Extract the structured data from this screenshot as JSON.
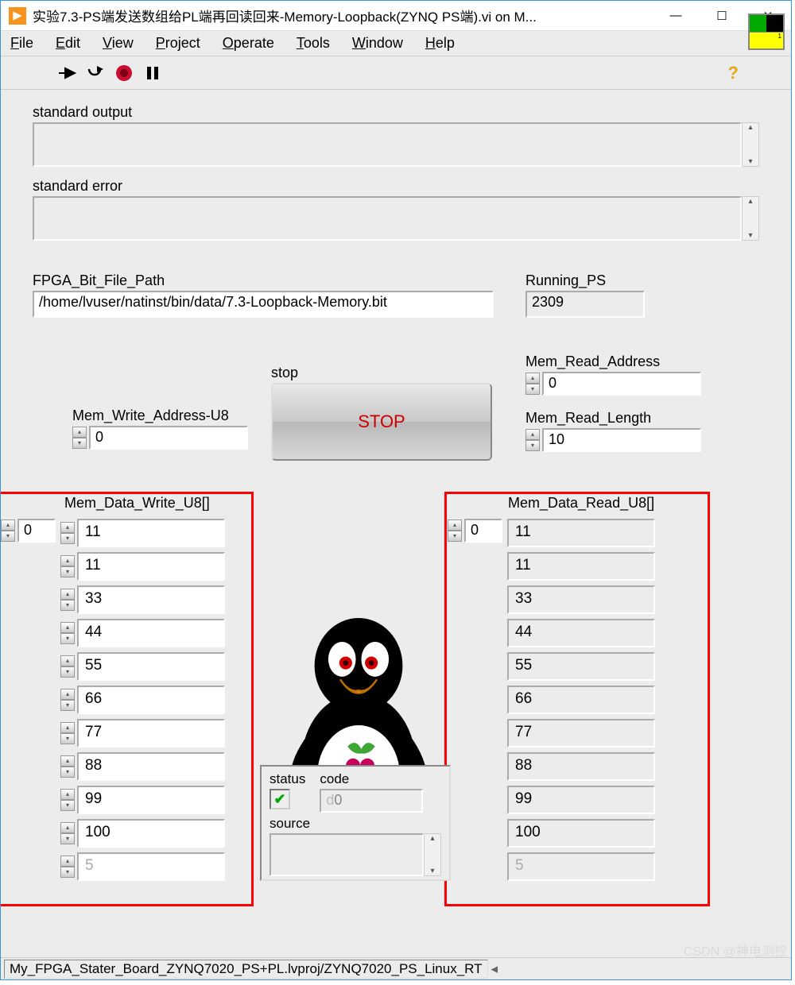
{
  "window": {
    "title": "实验7.3-PS端发送数组给PL端再回读回来-Memory-Loopback(ZYNQ PS端).vi on M..."
  },
  "menu": {
    "file": "File",
    "edit": "Edit",
    "view": "View",
    "project": "Project",
    "operate": "Operate",
    "tools": "Tools",
    "window": "Window",
    "help": "Help"
  },
  "labels": {
    "standard_output": "standard output",
    "standard_error": "standard error",
    "fpga_path": "FPGA_Bit_File_Path",
    "running_ps": "Running_PS",
    "stop_caption": "stop",
    "stop_button": "STOP",
    "mem_write_addr": "Mem_Write_Address-U8",
    "mem_read_addr": "Mem_Read_Address",
    "mem_read_len": "Mem_Read_Length",
    "mem_data_write": "Mem_Data_Write_U8[]",
    "mem_data_read": "Mem_Data_Read_U8[]",
    "status": "status",
    "code": "code",
    "source": "source"
  },
  "values": {
    "standard_output": "",
    "standard_error": "",
    "fpga_path": "/home/lvuser/natinst/bin/data/7.3-Loopback-Memory.bit",
    "running_ps": "2309",
    "mem_write_addr": "0",
    "mem_read_addr": "0",
    "mem_read_len": "10",
    "write_index": "0",
    "read_index": "0",
    "code": "0",
    "source": ""
  },
  "mem_data_write": [
    "11",
    "11",
    "33",
    "44",
    "55",
    "66",
    "77",
    "88",
    "99",
    "100",
    "5"
  ],
  "mem_data_read": [
    "11",
    "11",
    "33",
    "44",
    "55",
    "66",
    "77",
    "88",
    "99",
    "100",
    "5"
  ],
  "statusbar": "My_FPGA_Stater_Board_ZYNQ7020_PS+PL.lvproj/ZYNQ7020_PS_Linux_RT",
  "watermark": "CSDN @神电测控"
}
